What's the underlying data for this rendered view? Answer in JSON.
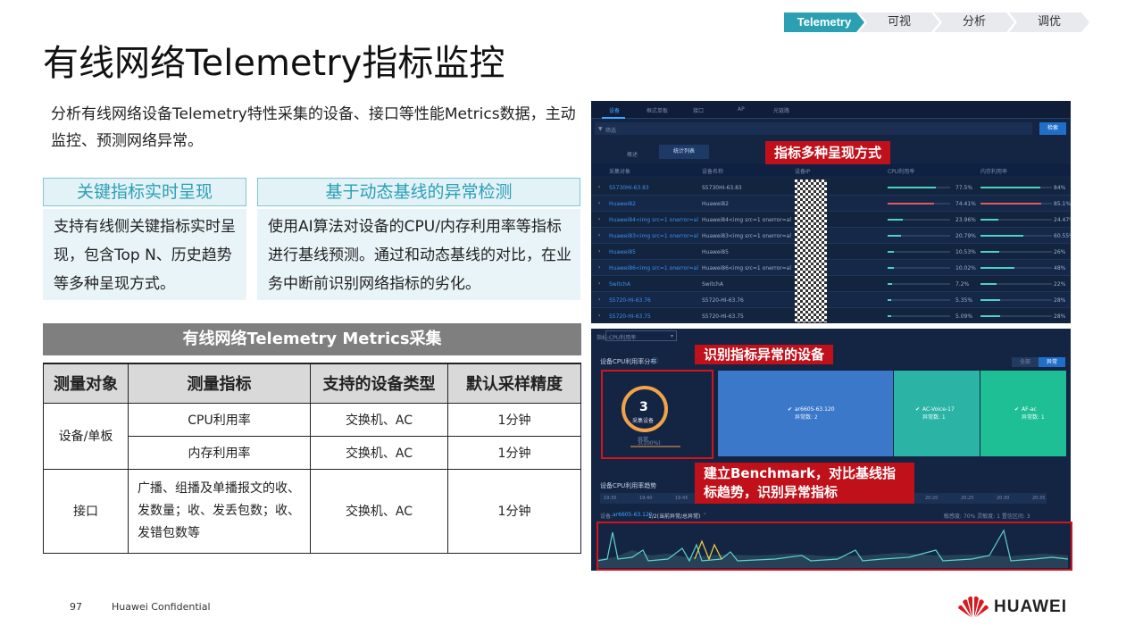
{
  "nav": {
    "items": [
      "Telemetry",
      "可视",
      "分析",
      "调优"
    ]
  },
  "title": "有线网络Telemetry指标监控",
  "intro": "分析有线网络设备Telemetry特性采集的设备、接口等性能Metrics数据，主动监控、预测网络异常。",
  "cards": [
    {
      "title": "关键指标实时呈现",
      "body": "支持有线侧关键指标实时呈现，包含Top N、历史趋势等多种呈现方式。"
    },
    {
      "title": "基于动态基线的异常检测",
      "body": "使用AI算法对设备的CPU/内存利用率等指标进行基线预测。通过和动态基线的对比，在业务中断前识别网络指标的劣化。"
    }
  ],
  "table": {
    "caption": "有线网络Telemetry Metrics采集",
    "headers": [
      "测量对象",
      "测量指标",
      "支持的设备类型",
      "默认采样精度"
    ],
    "rows": [
      {
        "object": "设备/单板",
        "metric": "CPU利用率",
        "devices": "交换机、AC",
        "precision": "1分钟"
      },
      {
        "metric": "内存利用率",
        "devices": "交换机、AC",
        "precision": "1分钟"
      },
      {
        "object": "接口",
        "metric": "广播、组播及单播报文的收、发数量；收、发丢包数；收、发错包数等",
        "devices": "交换机、AC",
        "precision": "1分钟"
      }
    ]
  },
  "dashboard_top": {
    "tabs": [
      "设备",
      "框式单板",
      "接口",
      "AP",
      "光链路"
    ],
    "filter": "筛选",
    "search": "检索",
    "subtabs": [
      "概述",
      "统计列表"
    ],
    "columns": [
      "采集对象",
      "设备名称",
      "设备IP",
      "CPU利用率",
      "内存利用率"
    ],
    "rows": [
      {
        "obj": "S5730HI-63.83",
        "name": "S5730HI-63.83",
        "cpu": "77.5%",
        "cpu_v": 0.775,
        "mem": "84%",
        "mem_v": 0.84,
        "cpu_color": "#4fd1c5",
        "mem_color": "#4fd1c5"
      },
      {
        "obj": "Huawei82",
        "name": "Huawei82",
        "cpu": "74.41%",
        "cpu_v": 0.744,
        "mem": "85.1%",
        "mem_v": 0.851,
        "cpu_color": "#e05a5a",
        "mem_color": "#e05a5a"
      },
      {
        "obj": "Huawei84<img src=1 onerror=alert...",
        "name": "Huawei84<img src=1 onerror=alert...",
        "cpu": "23.96%",
        "cpu_v": 0.24,
        "mem": "24.47%",
        "mem_v": 0.245,
        "cpu_color": "#4fd1c5",
        "mem_color": "#4fd1c5"
      },
      {
        "obj": "Huawei83<img src=1 onerror=alert...",
        "name": "Huawei83<img src=1 onerror=alert...",
        "cpu": "20.79%",
        "cpu_v": 0.208,
        "mem": "60.55%",
        "mem_v": 0.605,
        "cpu_color": "#4fd1c5",
        "mem_color": "#4fd1c5"
      },
      {
        "obj": "Huawei85",
        "name": "Huawei85",
        "cpu": "10.53%",
        "cpu_v": 0.105,
        "mem": "26%",
        "mem_v": 0.26,
        "cpu_color": "#4fd1c5",
        "mem_color": "#4fd1c5"
      },
      {
        "obj": "Huawei86<img src=1 onerror=alert...",
        "name": "Huawei86<img src=1 onerror=alert...",
        "cpu": "10.02%",
        "cpu_v": 0.1,
        "mem": "48%",
        "mem_v": 0.48,
        "cpu_color": "#4fd1c5",
        "mem_color": "#4fd1c5"
      },
      {
        "obj": "SwitchA",
        "name": "SwitchA",
        "cpu": "7.2%",
        "cpu_v": 0.072,
        "mem": "22%",
        "mem_v": 0.22,
        "cpu_color": "#4fd1c5",
        "mem_color": "#4fd1c5"
      },
      {
        "obj": "S5720-HI-63.76",
        "name": "S5720-HI-63.76",
        "cpu": "5.35%",
        "cpu_v": 0.054,
        "mem": "28%",
        "mem_v": 0.28,
        "cpu_color": "#4fd1c5",
        "mem_color": "#4fd1c5"
      },
      {
        "obj": "S5720-HI-63.75",
        "name": "S5720-HI-63.75",
        "cpu": "5.09%",
        "cpu_v": 0.051,
        "mem": "28%",
        "mem_v": 0.28,
        "cpu_color": "#4fd1c5",
        "mem_color": "#4fd1c5"
      }
    ],
    "callout": "指标多种呈现方式"
  },
  "dashboard_bottom": {
    "metric_label": "指标:",
    "metric_value": "CPU利用率",
    "dist_title": "设备CPU利用率分布",
    "toggle": [
      "全部",
      "异常"
    ],
    "gauge_value": "3",
    "gauge_label": "采集设备",
    "gauge_sub": "异常",
    "gauge_pct": "3(100%)",
    "tiles": [
      {
        "name": "ar6605-63.120",
        "sub": "异常数: 2",
        "color": "#3b78c9"
      },
      {
        "name": "AC-Voice-17",
        "sub": "异常数: 1",
        "color": "#2bb3a6"
      },
      {
        "name": "AF-ac",
        "sub": "异常数: 1",
        "color": "#1fbf96"
      }
    ],
    "trend_title": "设备CPU利用率趋势",
    "time_ticks": [
      "19:35",
      "19:40",
      "19:45",
      "19:50",
      "19:55",
      "20:00",
      "20:05",
      "20:10",
      "20:15",
      "20:20",
      "20:25",
      "20:30",
      "20:35"
    ],
    "device_label": "设备:",
    "device_value": "ar6605-63.120",
    "page_info": "1/2(当前异常/总异常)",
    "right_info": "敏感度: 70%   灵敏度: 1   置信区间: 3",
    "callout1": "识别指标异常的设备",
    "callout2": "建立Benchmark，对比基线指标趋势，识别异常指标"
  },
  "footer": {
    "page": "97",
    "confidential": "Huawei Confidential",
    "brand": "HUAWEI"
  }
}
